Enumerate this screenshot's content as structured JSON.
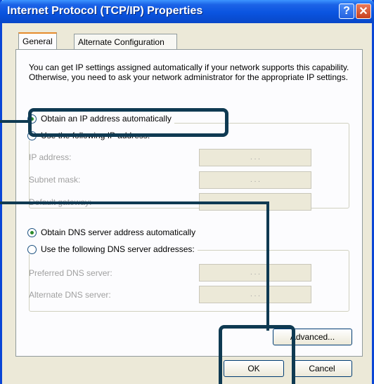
{
  "window": {
    "title": "Internet Protocol (TCP/IP) Properties",
    "help_glyph": "?",
    "close_glyph": "✕"
  },
  "tabs": [
    {
      "label": "General",
      "selected": true
    },
    {
      "label": "Alternate Configuration",
      "selected": false
    }
  ],
  "description": "You can get IP settings assigned automatically if your network supports this capability. Otherwise, you need to ask your network administrator for the appropriate IP settings.",
  "ip_section": {
    "auto_label": "Obtain an IP address automatically",
    "auto_selected": true,
    "manual_label": "Use the following IP address:",
    "fields": [
      {
        "label": "IP address:"
      },
      {
        "label": "Subnet mask:"
      },
      {
        "label": "Default gateway:"
      }
    ]
  },
  "dns_section": {
    "auto_label": "Obtain DNS server address automatically",
    "auto_selected": true,
    "manual_label": "Use the following DNS server addresses:",
    "fields": [
      {
        "label": "Preferred DNS server:"
      },
      {
        "label": "Alternate DNS server:"
      }
    ]
  },
  "ip_separator": ". . .",
  "buttons": {
    "advanced": "Advanced...",
    "ok": "OK",
    "cancel": "Cancel"
  },
  "colors": {
    "titlebar": "#0a54e0",
    "callout": "#0f3a52",
    "dialog_bg": "#ece9d8"
  }
}
